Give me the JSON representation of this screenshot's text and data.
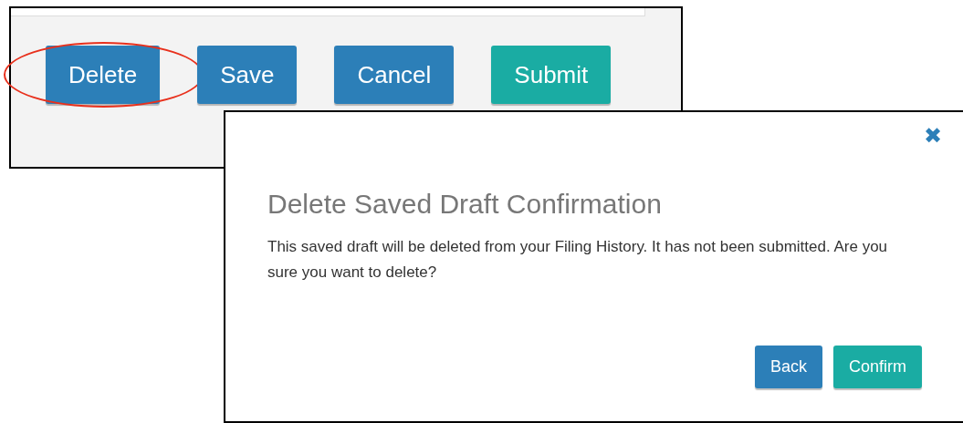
{
  "form_buttons": [
    {
      "label": "Delete",
      "kind": "primary",
      "circled": true
    },
    {
      "label": "Save",
      "kind": "primary",
      "circled": false
    },
    {
      "label": "Cancel",
      "kind": "primary",
      "circled": false
    },
    {
      "label": "Submit",
      "kind": "success",
      "circled": false
    }
  ],
  "dialog": {
    "close": "✖",
    "title": "Delete Saved Draft Confirmation",
    "message": "This saved draft will be deleted from your Filing History. It has not been submitted. Are you sure you want to delete?",
    "buttons": [
      {
        "label": "Back",
        "kind": "primary"
      },
      {
        "label": "Confirm",
        "kind": "success"
      }
    ]
  }
}
